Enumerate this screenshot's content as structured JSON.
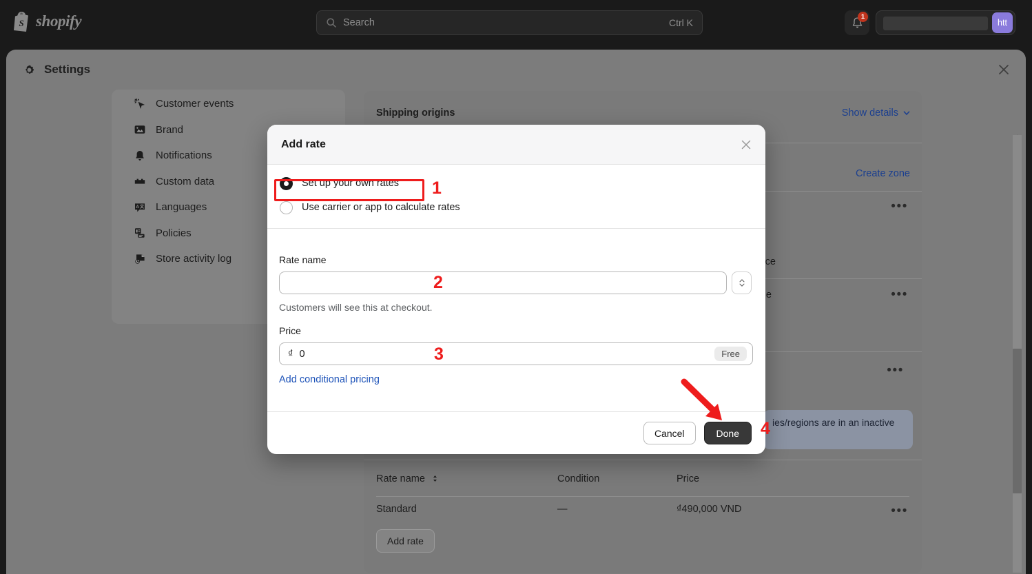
{
  "topbar": {
    "logo_text": "shopify",
    "search": {
      "placeholder": "Search",
      "shortcut": "Ctrl K"
    },
    "notifications": {
      "count": "1"
    },
    "avatar_initials": "htt"
  },
  "settings_window": {
    "title": "Settings"
  },
  "sidebar": {
    "items": [
      {
        "label": "Customer events",
        "icon": "cursor-click-icon"
      },
      {
        "label": "Brand",
        "icon": "image-icon"
      },
      {
        "label": "Notifications",
        "icon": "bell-icon"
      },
      {
        "label": "Custom data",
        "icon": "blocks-icon"
      },
      {
        "label": "Languages",
        "icon": "translate-icon"
      },
      {
        "label": "Policies",
        "icon": "policy-document-icon"
      },
      {
        "label": "Store activity log",
        "icon": "activity-clock-icon"
      }
    ]
  },
  "main": {
    "shipping_origins_title": "Shipping origins",
    "show_details_label": "Show details",
    "create_zone_label": "Create zone",
    "fragment_texts": [
      "ce",
      "e"
    ],
    "info_banner_text": "ies/regions are in an inactive",
    "table": {
      "headers": [
        "Rate name",
        "Condition",
        "Price"
      ],
      "rows": [
        {
          "rate_name": "Standard",
          "condition": "—",
          "price": "₫490,000 VND"
        }
      ],
      "add_rate_label": "Add rate"
    }
  },
  "modal": {
    "title": "Add rate",
    "radio_options": [
      {
        "label": "Set up your own rates",
        "selected": true
      },
      {
        "label": "Use carrier or app to calculate rates",
        "selected": false
      }
    ],
    "rate_name": {
      "label": "Rate name",
      "value": "",
      "placeholder": "",
      "helper": "Customers will see this at checkout."
    },
    "price": {
      "label": "Price",
      "currency_symbol": "₫",
      "value": "0",
      "badge": "Free"
    },
    "conditional_pricing_link": "Add conditional pricing",
    "cancel_label": "Cancel",
    "done_label": "Done"
  },
  "annotations": {
    "markers": [
      "1",
      "2",
      "3",
      "4"
    ],
    "color": "#ee1c1c"
  }
}
